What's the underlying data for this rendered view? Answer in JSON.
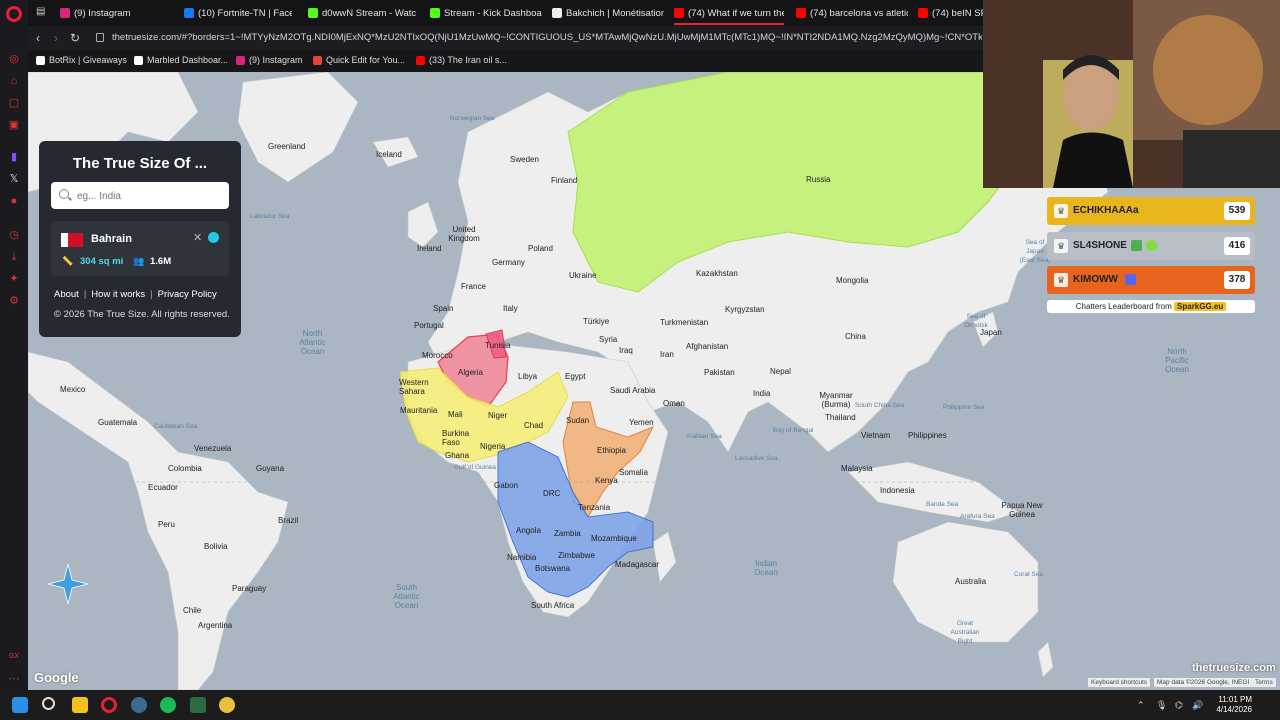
{
  "browser": {
    "tabs": [
      {
        "label": "(9) Instagram",
        "color": "#d6287a"
      },
      {
        "label": "(10) Fortnite-TN | Faceb",
        "color": "#1877f2"
      },
      {
        "label": "d0wwN Stream - Watch",
        "color": "#53fc18"
      },
      {
        "label": "Stream - Kick Dashboard",
        "color": "#53fc18"
      },
      {
        "label": "Bakchich | Monétisation",
        "color": "#eeeeee"
      },
      {
        "label": "(74) What if we turn the",
        "color": "#ff0000"
      },
      {
        "label": "(74) barcelona vs atletic",
        "color": "#ff0000"
      },
      {
        "label": "(74) beIN SP",
        "color": "#ff0000"
      }
    ],
    "url": "thetruesize.com/#?borders=1~!MTYyNzM2OTg.NDI0MjExNQ*MzU2NTIxOQ(NjU1MzUwMQ~!CONTIGUOUS_US*MTAwMjQwNzU.MjUwMjM1MTc(MTc1)MQ~!IN*NTI2NDA1MQ.Nzg2MzQyMQ)Mg~!CN*OTkyMTY5N",
    "bookmarks": [
      {
        "label": "BotRix | Giveaways",
        "color": "#ffffff"
      },
      {
        "label": "Marbled Dashboar...",
        "color": "#ffffff"
      },
      {
        "label": "(9) Instagram",
        "color": "#d6287a"
      },
      {
        "label": "Quick Edit for You...",
        "color": "#ea4335"
      },
      {
        "label": "(33) The Iran oil s...",
        "color": "#ff0000"
      }
    ]
  },
  "panel": {
    "title": "The True Size Of ...",
    "search_placeholder": "eg... India",
    "country": {
      "name": "Bahrain",
      "area": "304 sq mi",
      "population": "1.6M",
      "color": "#22c8e6"
    },
    "links": [
      "About",
      "How it works",
      "Privacy Policy"
    ],
    "copyright": "© 2026 The True Size. All rights reserved."
  },
  "map": {
    "country_labels": [
      {
        "text": "Greenland",
        "key": "greenland"
      },
      {
        "text": "Iceland",
        "key": "iceland"
      },
      {
        "text": "Sweden",
        "key": "sweden"
      },
      {
        "text": "Finland",
        "key": "finland"
      },
      {
        "text": "Russia",
        "key": "russia"
      },
      {
        "text": "United Kingdom",
        "key": "uk"
      },
      {
        "text": "Ireland",
        "key": "ireland"
      },
      {
        "text": "Poland",
        "key": "poland"
      },
      {
        "text": "Germany",
        "key": "germany"
      },
      {
        "text": "Ukraine",
        "key": "ukraine"
      },
      {
        "text": "France",
        "key": "france"
      },
      {
        "text": "Spain",
        "key": "spain"
      },
      {
        "text": "Portugal",
        "key": "portugal"
      },
      {
        "text": "Italy",
        "key": "italy"
      },
      {
        "text": "Türkiye",
        "key": "turkiye"
      },
      {
        "text": "Kazakhstan",
        "key": "kazakhstan"
      },
      {
        "text": "Mongolia",
        "key": "mongolia"
      },
      {
        "text": "Turkmenistan",
        "key": "turkmenistan"
      },
      {
        "text": "Kyrgyzstan",
        "key": "kyrgyzstan"
      },
      {
        "text": "Afghanistan",
        "key": "afghanistan"
      },
      {
        "text": "Syria",
        "key": "syria"
      },
      {
        "text": "Iraq",
        "key": "iraq"
      },
      {
        "text": "Iran",
        "key": "iran"
      },
      {
        "text": "China",
        "key": "china"
      },
      {
        "text": "Japan",
        "key": "japan"
      },
      {
        "text": "Morocco",
        "key": "morocco"
      },
      {
        "text": "Algeria",
        "key": "algeria"
      },
      {
        "text": "Tunisia",
        "key": "tunisia"
      },
      {
        "text": "Libya",
        "key": "libya"
      },
      {
        "text": "Egypt",
        "key": "egypt"
      },
      {
        "text": "Saudi Arabia",
        "key": "saudi"
      },
      {
        "text": "Oman",
        "key": "oman"
      },
      {
        "text": "Yemen",
        "key": "yemen"
      },
      {
        "text": "Pakistan",
        "key": "pakistan"
      },
      {
        "text": "Nepal",
        "key": "nepal"
      },
      {
        "text": "India",
        "key": "india"
      },
      {
        "text": "Myanmar (Burma)",
        "key": "myanmar"
      },
      {
        "text": "Thailand",
        "key": "thailand"
      },
      {
        "text": "Vietnam",
        "key": "vietnam"
      },
      {
        "text": "Philippines",
        "key": "philippines"
      },
      {
        "text": "Malaysia",
        "key": "malaysia"
      },
      {
        "text": "Indonesia",
        "key": "indonesia"
      },
      {
        "text": "Papua New Guinea",
        "key": "png"
      },
      {
        "text": "Australia",
        "key": "australia"
      },
      {
        "text": "Western Sahara",
        "key": "wsahara"
      },
      {
        "text": "Mauritania",
        "key": "mauritania"
      },
      {
        "text": "Mali",
        "key": "mali"
      },
      {
        "text": "Niger",
        "key": "niger"
      },
      {
        "text": "Chad",
        "key": "chad"
      },
      {
        "text": "Sudan",
        "key": "sudan"
      },
      {
        "text": "Burkina Faso",
        "key": "burkina"
      },
      {
        "text": "Nigeria",
        "key": "nigeria"
      },
      {
        "text": "Ghana",
        "key": "ghana"
      },
      {
        "text": "Ethiopia",
        "key": "ethiopia"
      },
      {
        "text": "Somalia",
        "key": "somalia"
      },
      {
        "text": "Kenya",
        "key": "kenya"
      },
      {
        "text": "Gabon",
        "key": "gabon"
      },
      {
        "text": "DRC",
        "key": "drc"
      },
      {
        "text": "Tanzania",
        "key": "tanzania"
      },
      {
        "text": "Angola",
        "key": "angola"
      },
      {
        "text": "Zambia",
        "key": "zambia"
      },
      {
        "text": "Mozambique",
        "key": "mozambique"
      },
      {
        "text": "Zimbabwe",
        "key": "zimbabwe"
      },
      {
        "text": "Namibia",
        "key": "namibia"
      },
      {
        "text": "Botswana",
        "key": "botswana"
      },
      {
        "text": "Madagascar",
        "key": "madagascar"
      },
      {
        "text": "South Africa",
        "key": "southafrica"
      },
      {
        "text": "Mexico",
        "key": "mexico"
      },
      {
        "text": "Guatemala",
        "key": "guatemala"
      },
      {
        "text": "Venezuela",
        "key": "venezuela"
      },
      {
        "text": "Colombia",
        "key": "colombia"
      },
      {
        "text": "Guyana",
        "key": "guyana"
      },
      {
        "text": "Ecuador",
        "key": "ecuador"
      },
      {
        "text": "Peru",
        "key": "peru"
      },
      {
        "text": "Brazil",
        "key": "brazil"
      },
      {
        "text": "Bolivia",
        "key": "bolivia"
      },
      {
        "text": "Paraguay",
        "key": "paraguay"
      },
      {
        "text": "Chile",
        "key": "chile"
      },
      {
        "text": "Argentina",
        "key": "argentina"
      }
    ],
    "ocean_labels": [
      {
        "text": "North Atlantic Ocean",
        "key": "natlantic"
      },
      {
        "text": "South Atlantic Ocean",
        "key": "satlantic"
      },
      {
        "text": "Indian Ocean",
        "key": "indian"
      },
      {
        "text": "North Pacific Ocean",
        "key": "npacific"
      },
      {
        "text": "Norwegian Sea",
        "key": "norwegian"
      },
      {
        "text": "Labrador Sea",
        "key": "labrador"
      },
      {
        "text": "Arabian Sea",
        "key": "arabian"
      },
      {
        "text": "Bay of Bengal",
        "key": "bengal"
      },
      {
        "text": "Laccadive Sea",
        "key": "laccadive"
      },
      {
        "text": "South China Sea",
        "key": "scs"
      },
      {
        "text": "Philippine Sea",
        "key": "philsea"
      },
      {
        "text": "Caribbean Sea",
        "key": "caribbean"
      },
      {
        "text": "Gulf of Guinea",
        "key": "guinea"
      },
      {
        "text": "Sea of Japan (East Sea)",
        "key": "seajapan"
      },
      {
        "text": "Sea of Okhotsk",
        "key": "okhotsk"
      },
      {
        "text": "Banda Sea",
        "key": "banda"
      },
      {
        "text": "Arafura Sea",
        "key": "arafura"
      },
      {
        "text": "Coral Sea",
        "key": "coral"
      },
      {
        "text": "Great Australian Bight",
        "key": "bight"
      }
    ],
    "google_logo": "Google",
    "watermark": "thetruesize.com",
    "attribution": [
      "Keyboard shortcuts",
      "Map data ©2026 Google, INEGI",
      "Terms"
    ]
  },
  "leaderboard": {
    "rows": [
      {
        "name": "ECHIKHAAAa",
        "score": "539",
        "color": "#e8b51c"
      },
      {
        "name": "SL4SHONE",
        "score": "416",
        "color": "#b9bec6"
      },
      {
        "name": "KIMOWW",
        "score": "378",
        "color": "#e8631c"
      }
    ],
    "footer_prefix": "Chatters Leaderboard from",
    "footer_brand": "SparkGG.eu"
  },
  "taskbar": {
    "time": "11:01 PM",
    "date": "4/14/2026"
  }
}
